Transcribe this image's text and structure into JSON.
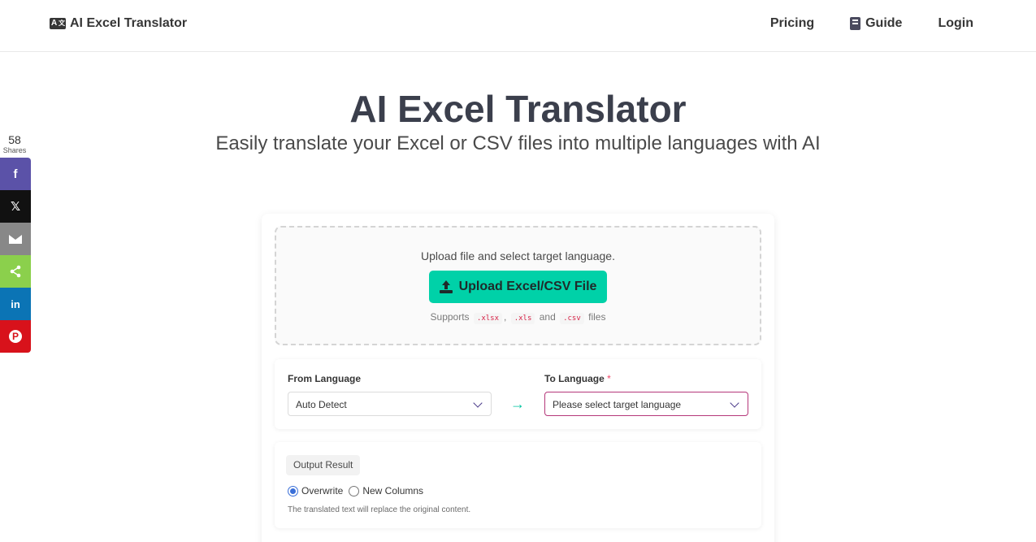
{
  "navbar": {
    "brand": "AI Excel Translator",
    "links": {
      "pricing": "Pricing",
      "guide": "Guide",
      "login": "Login"
    }
  },
  "share": {
    "count": "58",
    "count_label": "Shares",
    "buttons": [
      "facebook-icon",
      "x-icon",
      "email-icon",
      "share-icon",
      "linkedin-icon",
      "pinterest-icon"
    ],
    "glyphs": {
      "facebook": "f",
      "x": "𝕏",
      "linkedin": "in",
      "pinterest": "P"
    }
  },
  "hero": {
    "title": "AI Excel Translator",
    "subtitle": "Easily translate your Excel or CSV files into multiple languages with AI"
  },
  "upload": {
    "instruction": "Upload file and select target language.",
    "button_label": "Upload Excel/CSV File",
    "supports_prefix": "Supports",
    "ext_xlsx": ".xlsx",
    "comma": ",",
    "ext_xls": ".xls",
    "and": "and",
    "ext_csv": ".csv",
    "supports_suffix": "files"
  },
  "language": {
    "from_label": "From Language",
    "from_value": "Auto Detect",
    "to_label": "To Language",
    "required_mark": "*",
    "to_value": "Please select target language",
    "arrow": "→"
  },
  "output": {
    "tag": "Output Result",
    "options": [
      "Overwrite",
      "New Columns"
    ],
    "selected": "Overwrite",
    "hint": "The translated text will replace the original content."
  },
  "colors": {
    "accent": "#00d1a8",
    "share_facebook": "#5b52a8",
    "share_x": "#111111",
    "share_email": "#888888",
    "share_generic": "#8bd04c",
    "share_linkedin": "#0b74b5",
    "share_pinterest": "#d8121b"
  }
}
